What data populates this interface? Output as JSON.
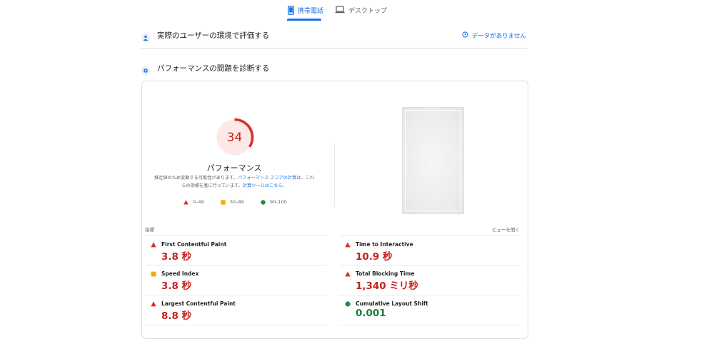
{
  "tabs": [
    {
      "label": "携帯電話",
      "icon": "phone-icon",
      "active": true
    },
    {
      "label": "デスクトップ",
      "icon": "laptop-icon",
      "active": false
    }
  ],
  "field_data": {
    "title": "実際のユーザーの環境で評価する",
    "icon": "people-icon",
    "no_data": "データがありません",
    "no_data_icon": "clock-icon"
  },
  "lab_data": {
    "title": "パフォーマンスの問題を診断する",
    "icon": "lab-icon"
  },
  "score": {
    "value": 34,
    "fraction": 0.34,
    "label": "パフォーマンス",
    "color": "#d93025",
    "bg": "#fce8e6"
  },
  "note": {
    "part1": "推定値のため変動する可能性があります。",
    "link1": "パフォーマンス スコアの計算",
    "part2": "は、これらの指標を基に行っています。",
    "link2": "計算ツールはこちら。"
  },
  "legend": [
    {
      "range": "0–49",
      "icon": "triangle-icon",
      "color": "#d93025"
    },
    {
      "range": "50–89",
      "icon": "square-icon",
      "color": "#f9ab00"
    },
    {
      "range": "90–100",
      "icon": "circle-icon",
      "color": "#1e8e3e"
    }
  ],
  "metrics_header": {
    "left": "指標",
    "right": "ビューを開く"
  },
  "metrics": [
    {
      "name": "First Contentful Paint",
      "value": "3.8 秒",
      "status": "fail"
    },
    {
      "name": "Time to Interactive",
      "value": "10.9 秒",
      "status": "fail"
    },
    {
      "name": "Speed Index",
      "value": "3.8 秒",
      "status": "average"
    },
    {
      "name": "Total Blocking Time",
      "value": "1,340 ミリ秒",
      "status": "fail"
    },
    {
      "name": "Largest Contentful Paint",
      "value": "8.8 秒",
      "status": "fail"
    },
    {
      "name": "Cumulative Layout Shift",
      "value": "0.001",
      "status": "pass"
    }
  ]
}
